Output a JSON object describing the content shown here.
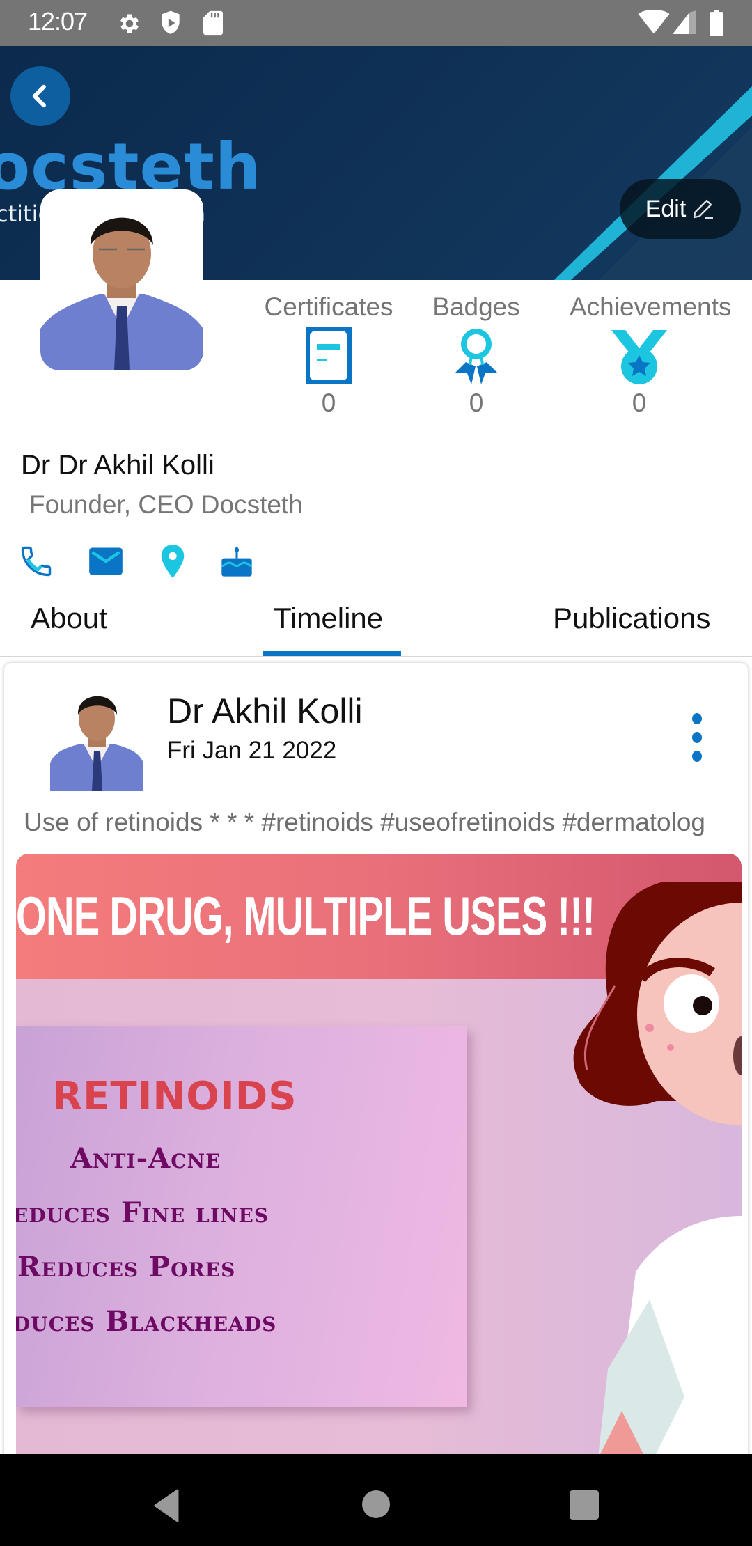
{
  "status_bar": {
    "time": "12:07",
    "left_icons": [
      "settings-icon",
      "shield-play-icon",
      "sd-card-icon"
    ],
    "right_icons": [
      "wifi-icon",
      "cell-signal-icon",
      "battery-icon"
    ]
  },
  "cover": {
    "brand_text": "ocsteth",
    "tagline_left": "ctitio",
    "tagline_right": "m",
    "back_icon": "chevron-left-icon",
    "edit_label": "Edit",
    "edit_icon": "pencil-icon",
    "colors": {
      "background": "#0f3155",
      "brand": "#2a8bd6",
      "stripe": "#1fb3d6"
    }
  },
  "profile": {
    "name": "Dr Dr Akhil Kolli",
    "title": "Founder, CEO Docsteth",
    "stats": [
      {
        "label": "Certificates",
        "count": "0",
        "icon": "certificate-icon"
      },
      {
        "label": "Badges",
        "count": "0",
        "icon": "ribbon-badge-icon"
      },
      {
        "label": "Achievements",
        "count": "0",
        "icon": "medal-icon"
      }
    ],
    "contacts": [
      "phone-icon",
      "email-icon",
      "location-icon",
      "birthday-cake-icon"
    ]
  },
  "tabs": {
    "items": [
      {
        "label": "About",
        "active": false
      },
      {
        "label": "Timeline",
        "active": true
      },
      {
        "label": "Publications",
        "active": false
      }
    ],
    "accent": "#0b75c5"
  },
  "post": {
    "author": "Dr Akhil Kolli",
    "date": "Fri Jan 21 2022",
    "menu_icon": "more-vertical-icon",
    "text": "Use of retinoids * * * #retinoids #useofretinoids #dermatolog",
    "image": {
      "headline": "ONE DRUG, MULTIPLE USES !!!",
      "heading": "RETINOIDS",
      "items": [
        "Anti-Acne",
        "educes Fine lines",
        "Reduces Pores",
        "duces Blackheads"
      ]
    }
  },
  "nav_bar": {
    "buttons": [
      "back-triangle-icon",
      "home-circle-icon",
      "recents-square-icon"
    ]
  }
}
